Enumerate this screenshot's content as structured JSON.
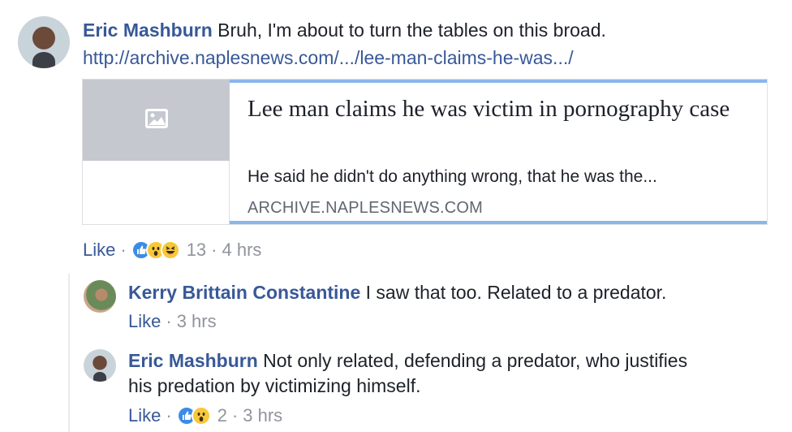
{
  "top_comment": {
    "author": "Eric Mashburn",
    "text": "Bruh, I'm about to turn the tables on this broad.",
    "link": "http://archive.naplesnews.com/.../lee-man-claims-he-was.../",
    "preview": {
      "title": "Lee man claims he was victim in pornography case",
      "description": "He said he didn't do anything wrong, that he was the...",
      "domain": "ARCHIVE.NAPLESNEWS.COM",
      "thumbnail_icon": "image-placeholder-icon"
    },
    "like_label": "Like",
    "reaction_icons": [
      "like-reaction-icon",
      "wow-reaction-icon",
      "haha-reaction-icon"
    ],
    "reaction_count": "13",
    "time": "4 hrs"
  },
  "replies": [
    {
      "author": "Kerry Brittain Constantine",
      "text": "I saw that too. Related to a predator.",
      "like_label": "Like",
      "time": "3 hrs"
    },
    {
      "author": "Eric Mashburn",
      "text_line1": "Not only related, defending a predator, who justifies",
      "text_line2": "his predation by victimizing himself.",
      "like_label": "Like",
      "reaction_icons": [
        "like-reaction-icon",
        "wow-reaction-icon"
      ],
      "reaction_count": "2",
      "time": "3 hrs"
    }
  ],
  "colors": {
    "link": "#385898",
    "meta": "#90949c",
    "preview_border_accent": "#8ab6ec",
    "thumb_bg": "#c5c8cf"
  }
}
